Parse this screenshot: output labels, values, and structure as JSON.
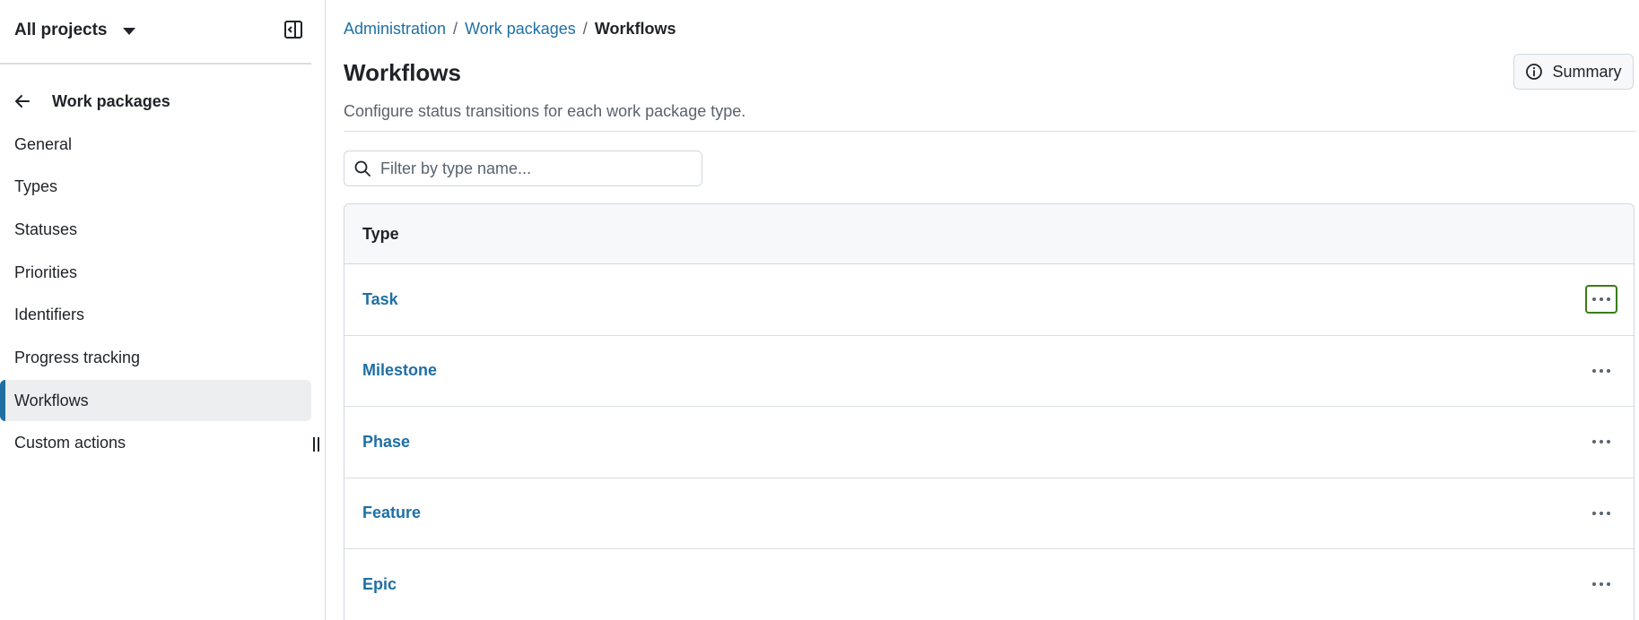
{
  "sidebar": {
    "project_switcher": "All projects",
    "back_label": "Work packages",
    "items": [
      {
        "label": "General",
        "active": false
      },
      {
        "label": "Types",
        "active": false
      },
      {
        "label": "Statuses",
        "active": false
      },
      {
        "label": "Priorities",
        "active": false
      },
      {
        "label": "Identifiers",
        "active": false
      },
      {
        "label": "Progress tracking",
        "active": false
      },
      {
        "label": "Workflows",
        "active": true
      },
      {
        "label": "Custom actions",
        "active": false
      }
    ]
  },
  "breadcrumb": {
    "items": [
      "Administration",
      "Work packages"
    ],
    "current": "Workflows",
    "separator": "/"
  },
  "header": {
    "title": "Workflows",
    "description": "Configure status transitions for each work package type.",
    "summary_label": "Summary"
  },
  "filter": {
    "placeholder": "Filter by type name...",
    "value": ""
  },
  "table": {
    "column": "Type",
    "rows": [
      {
        "name": "Task",
        "focused": true
      },
      {
        "name": "Milestone",
        "focused": false
      },
      {
        "name": "Phase",
        "focused": false
      },
      {
        "name": "Feature",
        "focused": false
      },
      {
        "name": "Epic",
        "focused": false
      }
    ]
  },
  "colors": {
    "link": "#1f6fa5",
    "active_indicator": "#1f6fa5",
    "focus_ring": "#3a7d17"
  },
  "icons": {
    "collapse": "sidebar-collapse-icon",
    "back": "arrow-left-icon",
    "info": "info-icon",
    "search": "search-icon",
    "more": "kebab-horizontal-icon"
  }
}
